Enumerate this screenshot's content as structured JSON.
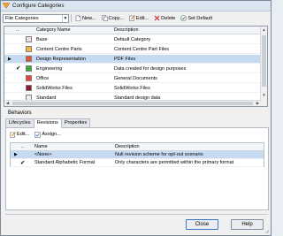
{
  "window": {
    "title": "Configure Categories"
  },
  "toolbar": {
    "category_combo_value": "File Categories",
    "new_label": "New...",
    "copy_label": "Copy...",
    "edit_label": "Edit...",
    "delete_label": "Delete",
    "set_default_label": "Set Default"
  },
  "categories": {
    "headers": {
      "marker": "",
      "default": "",
      "color": "",
      "name": "Category Name",
      "description": "Description"
    },
    "rows": [
      {
        "name": "Base",
        "description": "Default Category",
        "color": "#f2dede",
        "is_default": false,
        "current": false
      },
      {
        "name": "Content Centre Parts",
        "description": "Content Centre Part Files",
        "color": "#f5b640",
        "is_default": false,
        "current": false
      },
      {
        "name": "Design Representation",
        "description": "PDF Files",
        "color": "#e8542e",
        "is_default": false,
        "current": true
      },
      {
        "name": "Engineering",
        "description": "Data created for design purposes",
        "color": "#3ba935",
        "is_default": true,
        "current": false
      },
      {
        "name": "Office",
        "description": "General Documents",
        "color": "#ef3e3e",
        "is_default": false,
        "current": false
      },
      {
        "name": "SolidWorks Files",
        "description": "SolidWorks Files",
        "color": "#8a1a2c",
        "is_default": false,
        "current": false
      },
      {
        "name": "Standard",
        "description": "Standard design data",
        "color": "#ececec",
        "is_default": false,
        "current": false
      }
    ]
  },
  "behaviors": {
    "label": "Behaviors",
    "tabs": [
      {
        "label": "Lifecycles",
        "active": false
      },
      {
        "label": "Revisions",
        "active": true
      },
      {
        "label": "Properties",
        "active": false
      }
    ],
    "edit_label": "Edit...",
    "assign_label": "Assign...",
    "revisions": {
      "headers": {
        "marker": "",
        "name": "Name",
        "description": "Description"
      },
      "rows": [
        {
          "name": "<None>",
          "description": "Null revision scheme for opt-out scenario",
          "checked": false,
          "selected": true,
          "current": true
        },
        {
          "name": "Standard Alphabetic Format",
          "description": "Only characters are permitted within the primary format",
          "checked": true,
          "selected": false,
          "current": false
        }
      ]
    }
  },
  "footer": {
    "close_label": "Close",
    "help_label": "Help"
  },
  "icons": {
    "app": "configure-icon",
    "new": "new-icon",
    "copy": "copy-icon",
    "edit": "edit-icon",
    "delete": "delete-icon",
    "set_default": "set-default-icon",
    "current_row": "row-pointer-icon",
    "default_check": "checkmark-icon"
  },
  "colors": {
    "selection": "#c6dbf2",
    "window_bg": "#f0f0f0",
    "default_button_border": "#3d78c8"
  }
}
